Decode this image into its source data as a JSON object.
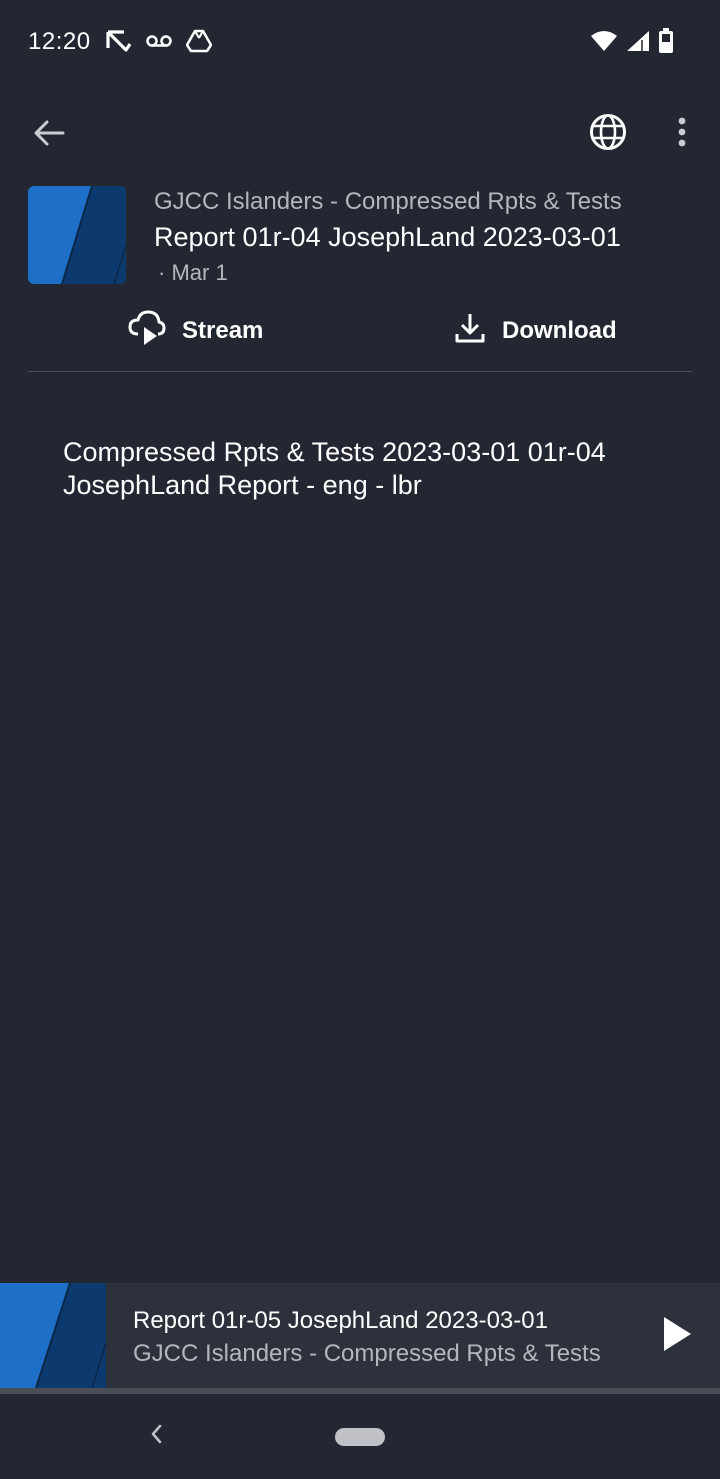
{
  "status_bar": {
    "time": "12:20",
    "left_icons": [
      "missed-call-icon",
      "voicemail-icon",
      "drive-icon"
    ],
    "right_icons": [
      "wifi-icon",
      "signal-icon",
      "battery-icon"
    ]
  },
  "app_bar": {
    "icons": [
      "back-arrow-icon",
      "globe-icon",
      "more-vert-icon"
    ]
  },
  "episode": {
    "channel": "GJCC Islanders - Compressed Rpts & Tests",
    "title": "Report 01r-04 JosephLand 2023-03-01",
    "date": "· Mar 1",
    "description": "Compressed Rpts & Tests 2023-03-01 01r-04 JosephLand Report - eng - lbr"
  },
  "actions": {
    "stream_label": "Stream",
    "download_label": "Download"
  },
  "mini_player": {
    "title": "Report 01r-05 JosephLand 2023-03-01",
    "subtitle": "GJCC Islanders - Compressed Rpts & Tests",
    "progress": 0
  },
  "colors": {
    "background": "#232731",
    "mini_player_bg": "#2d313b",
    "secondary_text": "#b3b6bc",
    "thumbnail_blue": "#1e6fc8",
    "thumbnail_dark": "#0d3a6e"
  }
}
